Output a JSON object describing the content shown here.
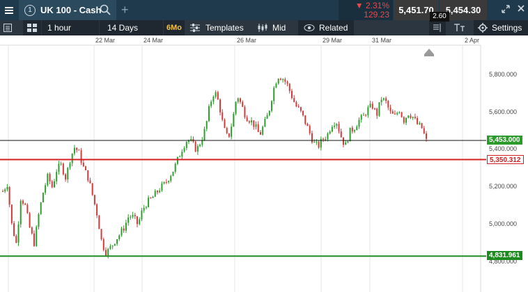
{
  "header": {
    "tab_number": "1",
    "instrument": "UK 100 - Cash",
    "change_pct": "▼ 2.31%",
    "change_abs": "129.23",
    "sell_price": "5,451.70",
    "buy_price": "5,454.30",
    "spread": "2.60"
  },
  "toolbar": {
    "interval": "1 hour",
    "period": "14 Days",
    "timeframe_badge": "6Mo",
    "templates": "Templates",
    "price_type": "Mid",
    "related": "Related",
    "settings": "Settings"
  },
  "x_labels": [
    "22 Mar",
    "24 Mar",
    "26 Mar",
    "29 Mar",
    "31 Mar",
    "2 Apr"
  ],
  "y_labels": [
    "5,800.000",
    "5,600.000",
    "5,400.000",
    "5,200.000",
    "5,000.000",
    "4,800.000"
  ],
  "price_tags": {
    "current": "5,453.000",
    "resistance": "5,350.312",
    "support": "4,831.961"
  },
  "colors": {
    "up": "#2e9e2e",
    "down": "#d13b3b",
    "resistance_line": "#d42020",
    "support_line": "#1c8a1c",
    "current_line": "#111111",
    "current_tag": "#2b9b2b"
  },
  "chart_data": {
    "type": "candlestick",
    "x": [
      "22 Mar",
      "24 Mar",
      "26 Mar",
      "29 Mar",
      "31 Mar",
      "2 Apr"
    ],
    "ylim": [
      4780,
      5900
    ],
    "y_ticks": [
      4800,
      5000,
      5200,
      5400,
      5600,
      5800
    ],
    "lines": {
      "current": 5453,
      "resistance": 5350.312,
      "support": 4831.961
    },
    "close_path": [
      5180,
      5220,
      5000,
      4900,
      5150,
      5100,
      4980,
      4900,
      5060,
      5180,
      5260,
      5200,
      5300,
      5320,
      5250,
      5360,
      5420,
      5380,
      5300,
      5250,
      5150,
      5050,
      4900,
      4850,
      4880,
      4920,
      4950,
      4990,
      5050,
      5040,
      5000,
      5080,
      5120,
      5140,
      5170,
      5200,
      5220,
      5260,
      5300,
      5360,
      5420,
      5460,
      5440,
      5400,
      5450,
      5520,
      5650,
      5720,
      5650,
      5520,
      5460,
      5560,
      5700,
      5640,
      5580,
      5560,
      5530,
      5480,
      5540,
      5600,
      5720,
      5800,
      5790,
      5760,
      5700,
      5640,
      5610,
      5560,
      5500,
      5440,
      5420,
      5460,
      5480,
      5540,
      5560,
      5480,
      5420,
      5500,
      5520,
      5560,
      5580,
      5620,
      5640,
      5590,
      5680,
      5660,
      5600,
      5580,
      5620,
      5560,
      5600,
      5580,
      5540,
      5520,
      5450
    ]
  }
}
